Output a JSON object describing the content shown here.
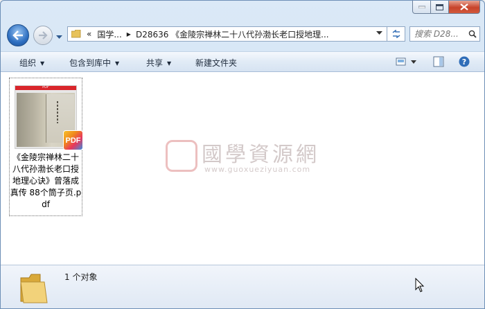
{
  "window": {
    "buttons": {
      "minimize_icon": "minimize-icon",
      "maximize_icon": "maximize-icon",
      "close_icon": "close-icon"
    }
  },
  "nav": {
    "back_icon": "back-arrow-icon",
    "forward_icon": "forward-arrow-icon",
    "address": {
      "overflow": "«",
      "segments": [
        "国学...",
        "D28636 《金陵宗禅林二十八代孙渤长老口授地理..."
      ]
    },
    "search_placeholder": "搜索 D28..."
  },
  "toolbar": {
    "organize": "组织",
    "include_library": "包含到库中",
    "share": "共享",
    "new_folder": "新建文件夹"
  },
  "files": [
    {
      "name": "《金陵宗禅林二十八代孙渤长老口授地理心诀》曾落成真传 88个筒子页.pdf",
      "thumb_label": "PDF",
      "badge": "PDF"
    }
  ],
  "watermark": {
    "title": "國學資源網",
    "url": "www.guoxueziyuan.com"
  },
  "status": {
    "count": "1 个对象"
  },
  "colors": {
    "pdf_red": "#d9252b",
    "close_red": "#c7432a",
    "toolbar_blue": "#d6e3f2"
  }
}
